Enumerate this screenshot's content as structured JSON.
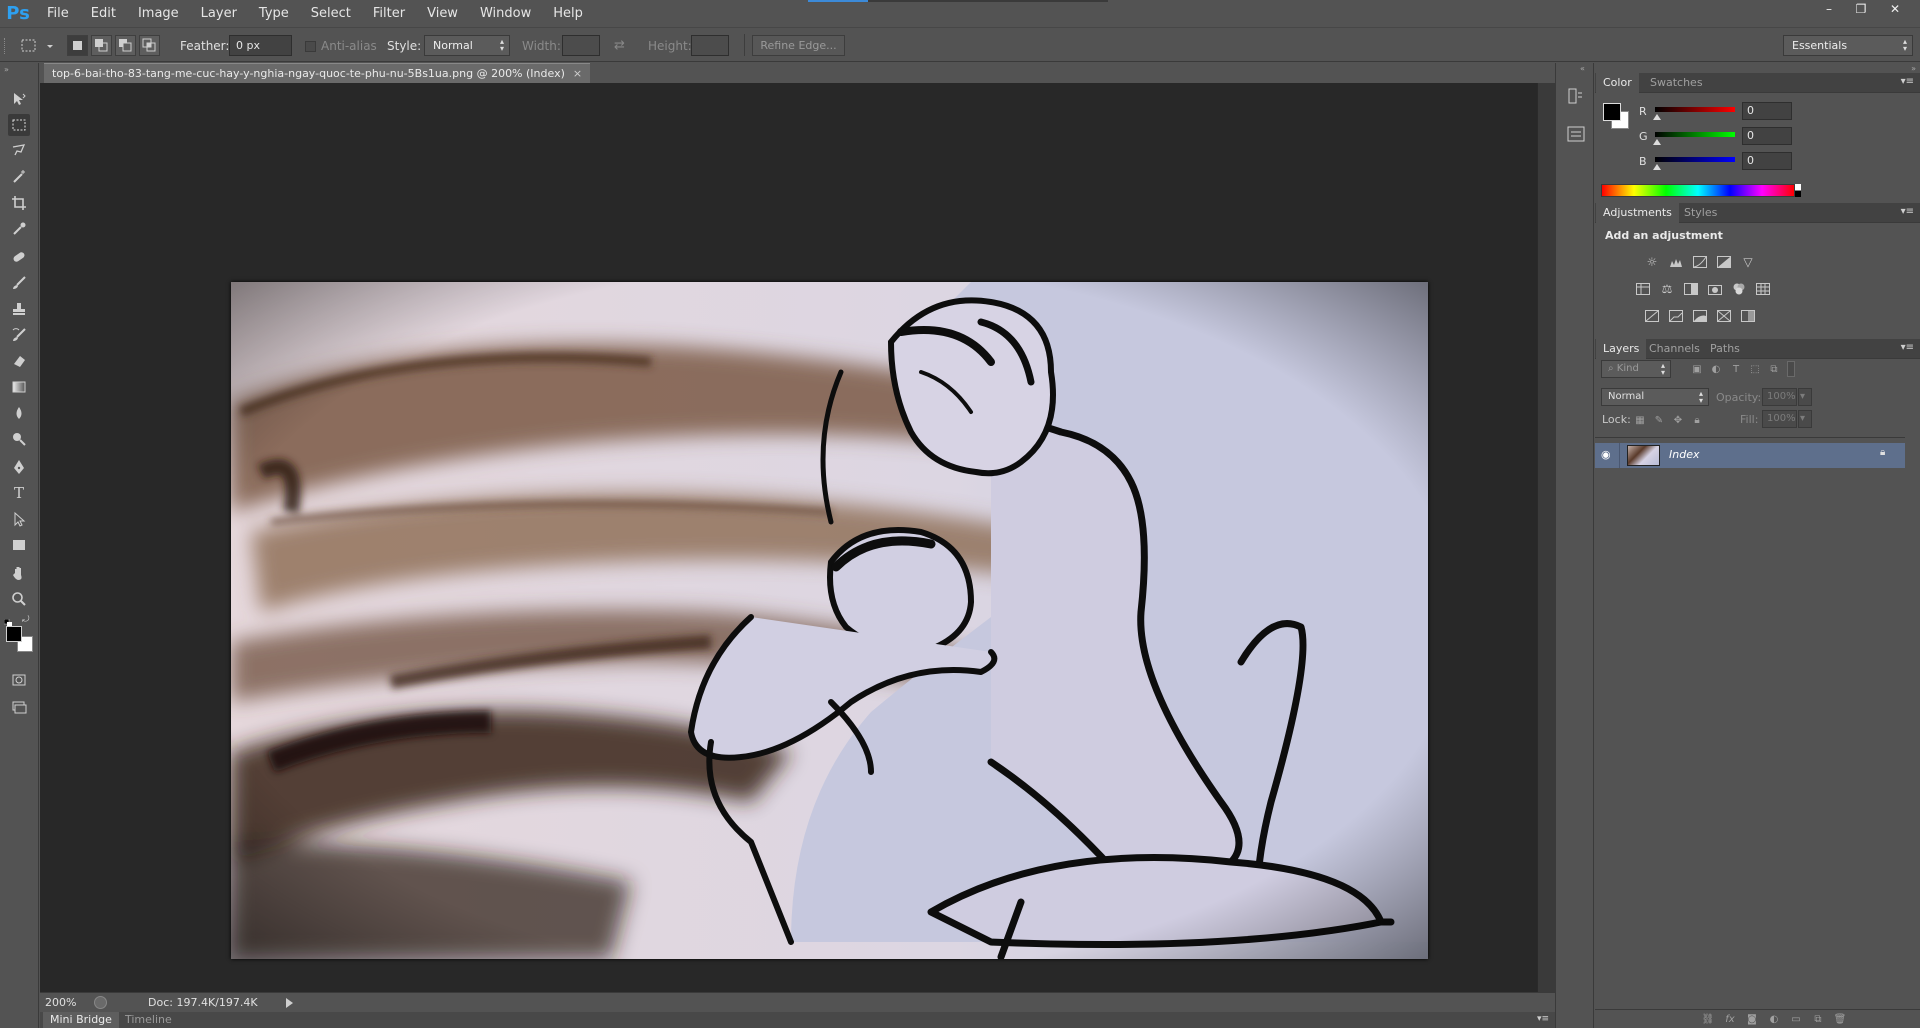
{
  "app": {
    "logo": "Ps",
    "menu": [
      "File",
      "Edit",
      "Image",
      "Layer",
      "Type",
      "Select",
      "Filter",
      "View",
      "Window",
      "Help"
    ],
    "window_controls": [
      "–",
      "❐",
      "✕"
    ]
  },
  "options": {
    "feather_label": "Feather:",
    "feather_value": "0 px",
    "antialias_label": "Anti-alias",
    "style_label": "Style:",
    "style_value": "Normal",
    "width_label": "Width:",
    "height_label": "Height:",
    "refine_edge_label": "Refine Edge...",
    "workspace_value": "Essentials"
  },
  "document": {
    "tab_title": "top-6-bai-tho-83-tang-me-cuc-hay-y-nghia-ngay-quoc-te-phu-nu-5Bs1ua.png @ 200% (Index)",
    "tab_close": "×",
    "zoom": "200%",
    "doc_size": "Doc: 197.4K/197.4K"
  },
  "bottom_tabs": [
    "Mini Bridge",
    "Timeline"
  ],
  "color_panel": {
    "tabs": [
      "Color",
      "Swatches"
    ],
    "r_label": "R",
    "r_value": "0",
    "g_label": "G",
    "g_value": "0",
    "b_label": "B",
    "b_value": "0",
    "foreground": "#000000",
    "background": "#ffffff"
  },
  "adjustments_panel": {
    "tabs": [
      "Adjustments",
      "Styles"
    ],
    "heading": "Add an adjustment",
    "icons": [
      "brightness-icon",
      "levels-icon",
      "curves-icon",
      "exposure-icon",
      "vibrance-icon",
      "hue-saturation-icon",
      "color-balance-icon",
      "black-white-icon",
      "photo-filter-icon",
      "channel-mixer-icon",
      "color-lookup-icon",
      "invert-icon",
      "posterize-icon",
      "threshold-icon",
      "gradient-map-icon",
      "selective-color-icon"
    ]
  },
  "layers_panel": {
    "tabs": [
      "Layers",
      "Channels",
      "Paths"
    ],
    "kind_label": "Kind",
    "blend_mode": "Normal",
    "opacity_label": "Opacity:",
    "opacity_value": "100%",
    "lock_label": "Lock:",
    "fill_label": "Fill:",
    "fill_value": "100%",
    "layers": [
      {
        "name": "Index",
        "visible": true,
        "locked": true
      }
    ]
  },
  "colors": {
    "accent_selected_layer": "#5e6f8c",
    "app_bg": "#535353",
    "canvas_bg": "#282828"
  }
}
